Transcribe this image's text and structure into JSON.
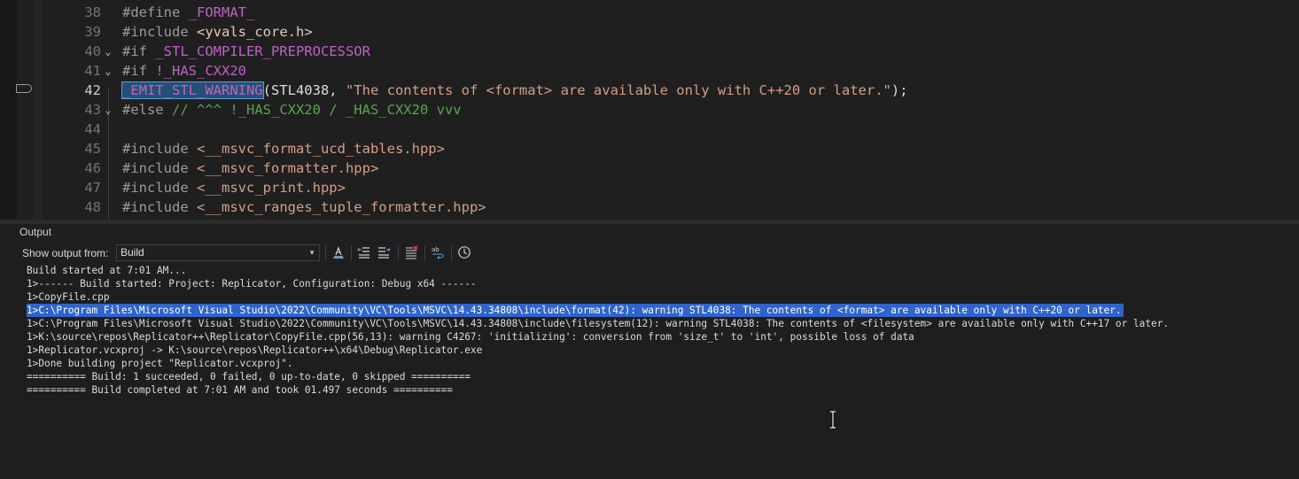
{
  "editor": {
    "lines": [
      {
        "num": "38",
        "tokens": [
          {
            "t": "#define ",
            "c": "pp"
          },
          {
            "t": "_FORMAT_",
            "c": "mac"
          }
        ]
      },
      {
        "num": "39",
        "tokens": [
          {
            "t": "#include ",
            "c": "pp"
          },
          {
            "t": "<yvals_core.h>",
            "c": "str"
          }
        ]
      },
      {
        "num": "40",
        "fold": "⌄",
        "tokens": [
          {
            "t": "#if ",
            "c": "pp"
          },
          {
            "t": "_STL_COMPILER_PREPROCESSOR",
            "c": "mac"
          }
        ]
      },
      {
        "num": "41",
        "fold": "⌄",
        "tokens": [
          {
            "t": "#if ",
            "c": "pp"
          },
          {
            "t": "!_HAS_CXX20",
            "c": "mac"
          }
        ]
      },
      {
        "num": "42",
        "current": true,
        "tokens": [
          {
            "t": "_EMIT_STL_WARNING",
            "c": "mac sel"
          },
          {
            "t": "(STL4038, ",
            "c": "pln"
          },
          {
            "t": "\"The contents of <format> are available only with C++20 or later.\"",
            "c": "strorange"
          },
          {
            "t": ");",
            "c": "pln"
          }
        ]
      },
      {
        "num": "43",
        "fold": "⌄",
        "tokens": [
          {
            "t": "#else ",
            "c": "pp"
          },
          {
            "t": "// ^^^ !_HAS_CXX20 / _HAS_CXX20 vvv",
            "c": "cmt"
          }
        ]
      },
      {
        "num": "44",
        "tokens": []
      },
      {
        "num": "45",
        "tokens": [
          {
            "t": "#include ",
            "c": "pp"
          },
          {
            "t": "<__msvc_format_ucd_tables.hpp>",
            "c": "strorange"
          }
        ]
      },
      {
        "num": "46",
        "tokens": [
          {
            "t": "#include ",
            "c": "pp"
          },
          {
            "t": "<__msvc_formatter.hpp>",
            "c": "strorange"
          }
        ]
      },
      {
        "num": "47",
        "tokens": [
          {
            "t": "#include ",
            "c": "pp"
          },
          {
            "t": "<__msvc_print.hpp>",
            "c": "strorange"
          }
        ]
      },
      {
        "num": "48",
        "tokens": [
          {
            "t": "#include ",
            "c": "pp"
          },
          {
            "t": "<__msvc_ranges_tuple_formatter.hpp>",
            "c": "strorange"
          }
        ]
      }
    ]
  },
  "output": {
    "title": "Output",
    "show_from_label": "Show output from:",
    "source": "Build",
    "lines": [
      "Build started at 7:01 AM...",
      "1>------ Build started: Project: Replicator, Configuration: Debug x64 ------",
      "1>CopyFile.cpp",
      "1>C:\\Program Files\\Microsoft Visual Studio\\2022\\Community\\VC\\Tools\\MSVC\\14.43.34808\\include\\format(42): warning STL4038: The contents of <format> are available only with C++20 or later.",
      "1>C:\\Program Files\\Microsoft Visual Studio\\2022\\Community\\VC\\Tools\\MSVC\\14.43.34808\\include\\filesystem(12): warning STL4038: The contents of <filesystem> are available only with C++17 or later.",
      "1>K:\\source\\repos\\Replicator++\\Replicator\\CopyFile.cpp(56,13): warning C4267: 'initializing': conversion from 'size_t' to 'int', possible loss of data",
      "1>Replicator.vcxproj -> K:\\source\\repos\\Replicator++\\x64\\Debug\\Replicator.exe",
      "1>Done building project \"Replicator.vcxproj\".",
      "========== Build: 1 succeeded, 0 failed, 0 up-to-date, 0 skipped ==========",
      "========== Build completed at 7:01 AM and took 01.497 seconds =========="
    ],
    "highlighted_line": 3
  }
}
